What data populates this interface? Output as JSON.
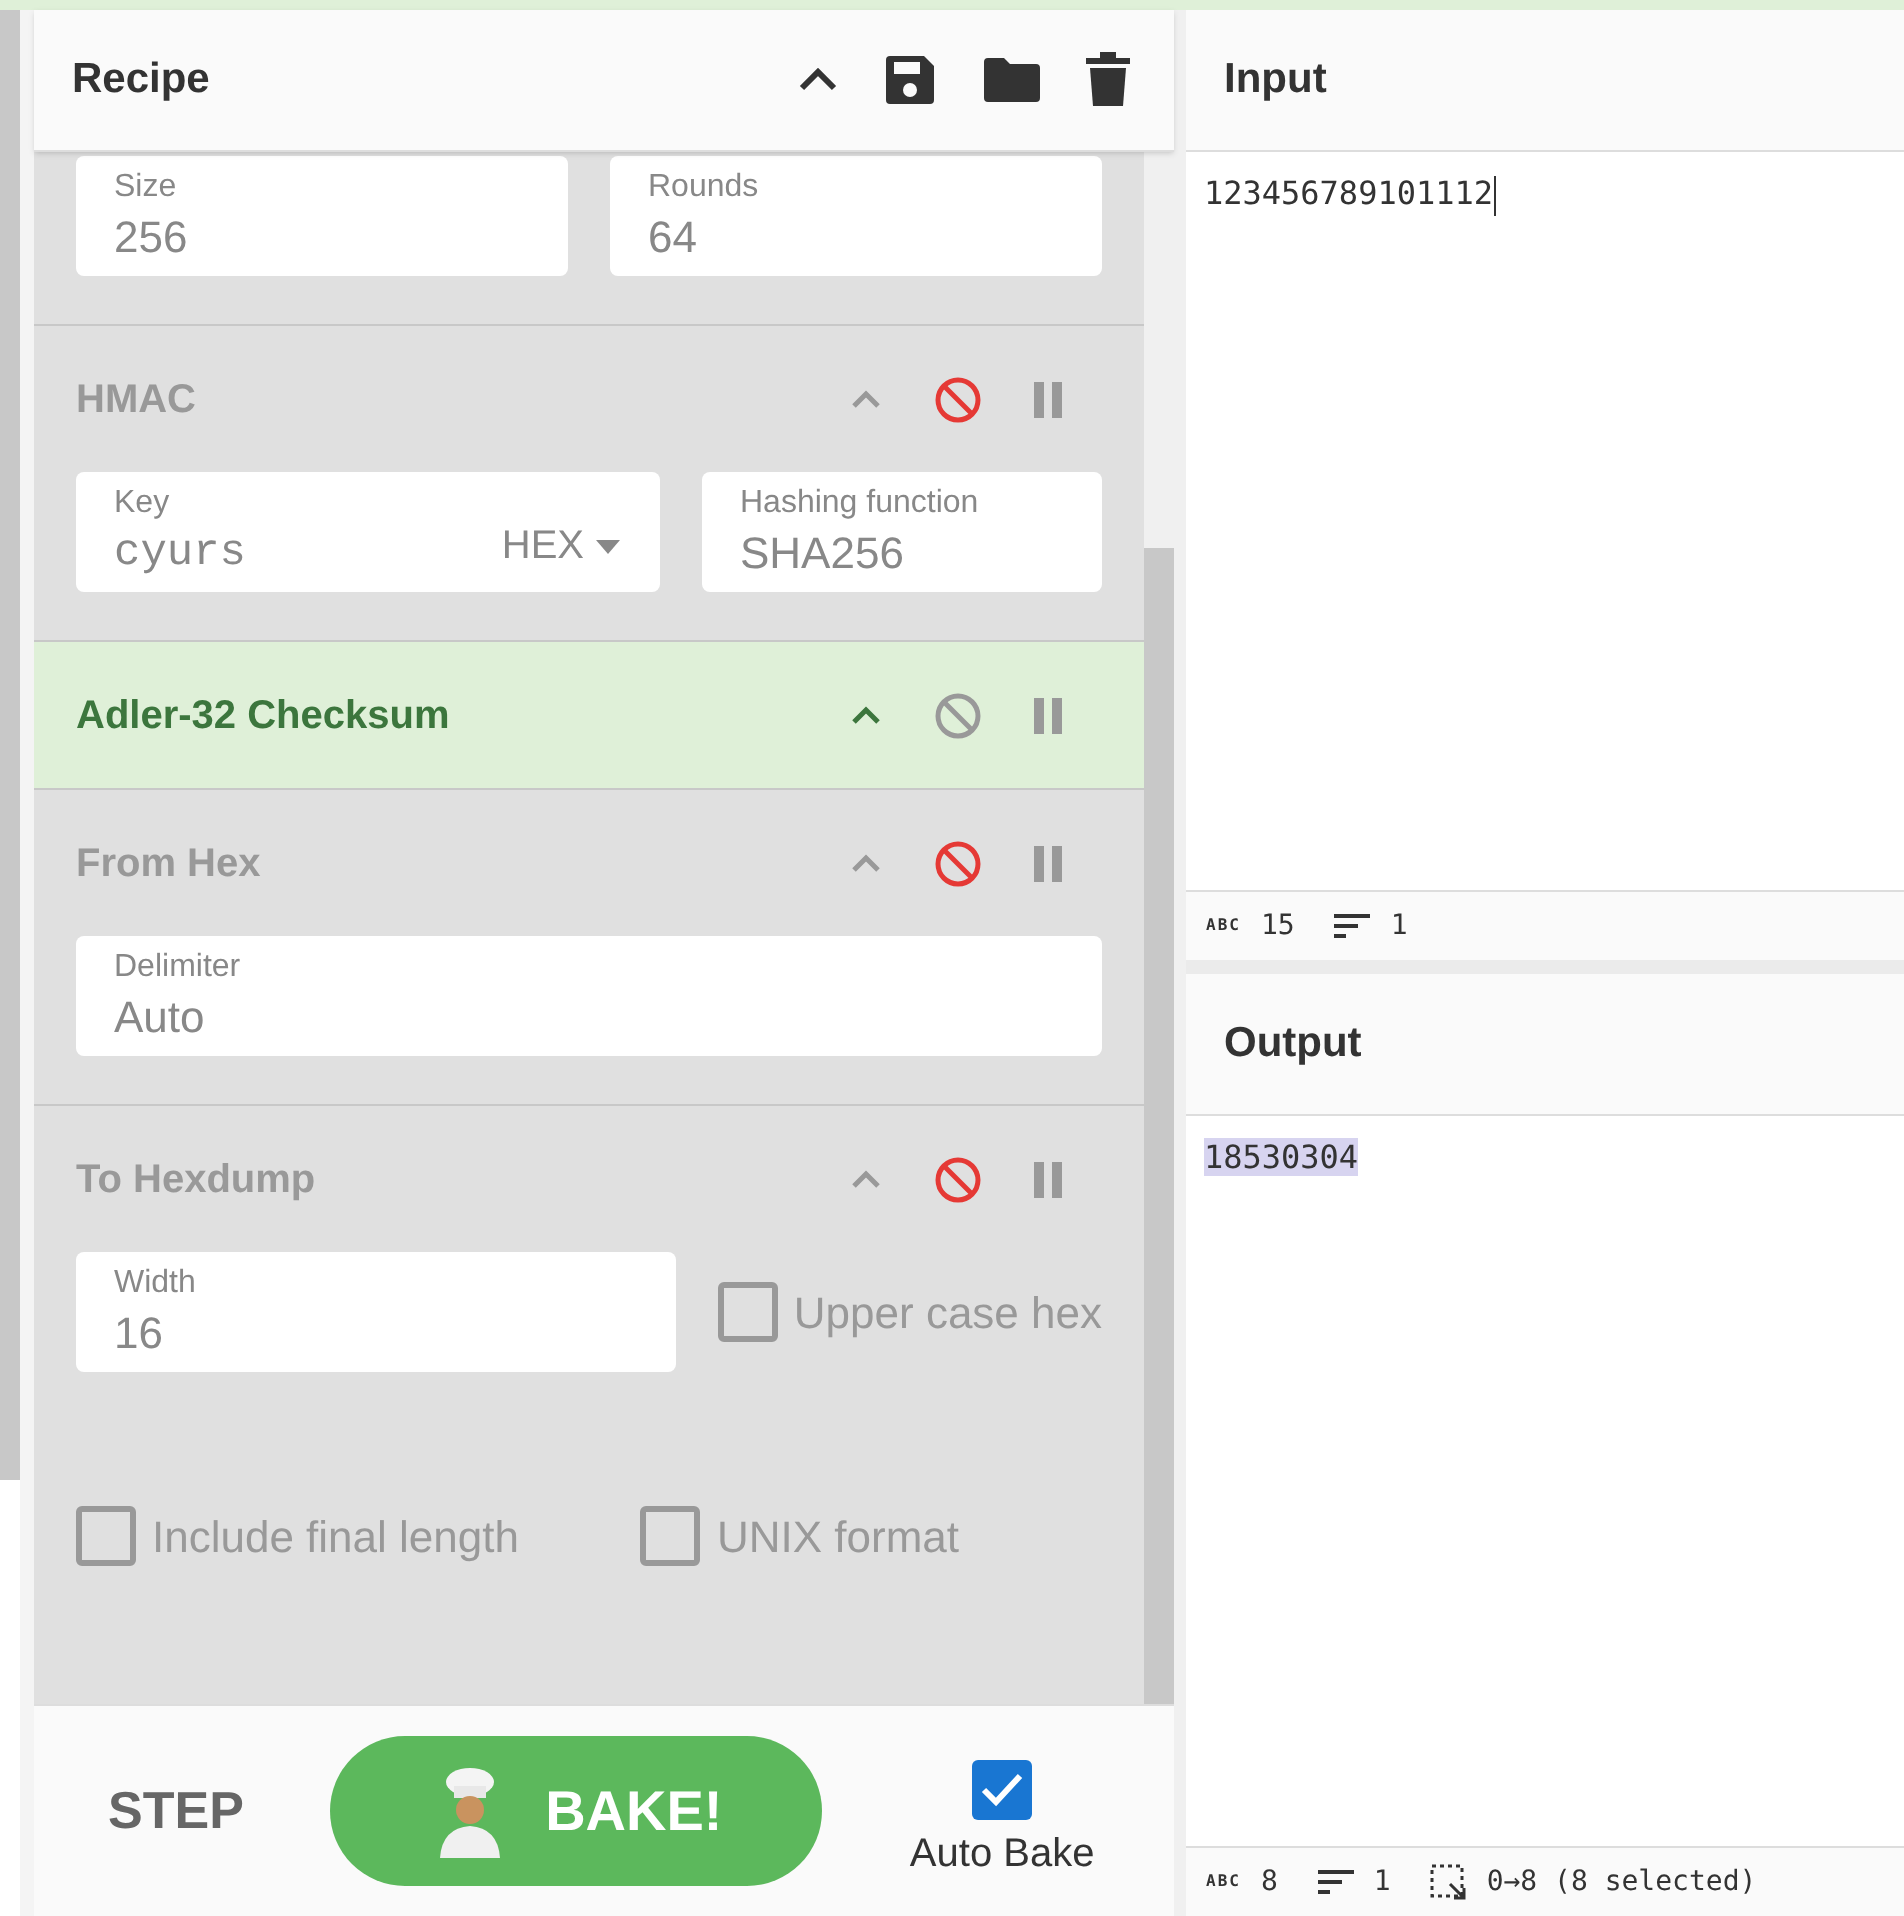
{
  "recipe": {
    "title": "Recipe",
    "operations": [
      {
        "disabled": true,
        "args": [
          {
            "kind": "text",
            "label": "Size",
            "value": "256"
          },
          {
            "kind": "text",
            "label": "Rounds",
            "value": "64"
          }
        ]
      },
      {
        "title": "HMAC",
        "disabled": true,
        "args": [
          {
            "kind": "toggle",
            "label": "Key",
            "value": "cyurs",
            "toggle": "HEX"
          },
          {
            "kind": "text",
            "label": "Hashing function",
            "value": "SHA256"
          }
        ]
      },
      {
        "title": "Adler-32 Checksum",
        "disabled": false
      },
      {
        "title": "From Hex",
        "disabled": true,
        "args": [
          {
            "kind": "text",
            "label": "Delimiter",
            "value": "Auto"
          }
        ]
      },
      {
        "title": "To Hexdump",
        "disabled": true,
        "args": [
          {
            "kind": "text",
            "label": "Width",
            "value": "16"
          },
          {
            "kind": "checkbox",
            "label": "Upper case hex",
            "checked": false
          },
          {
            "kind": "checkbox",
            "label": "Include final length",
            "checked": false
          },
          {
            "kind": "checkbox",
            "label": "UNIX format",
            "checked": false
          }
        ]
      }
    ],
    "step": "STEP",
    "bake": "BAKE!",
    "auto_bake": {
      "label": "Auto Bake",
      "checked": true
    }
  },
  "input": {
    "title": "Input",
    "text": "123456789101112",
    "status": {
      "length_label": "ABC",
      "length": "15",
      "lines": "1"
    }
  },
  "output": {
    "title": "Output",
    "text": "18530304",
    "selected": true,
    "status": {
      "length_label": "ABC",
      "length": "8",
      "lines": "1",
      "selection": "0→8 (8 selected)"
    }
  }
}
